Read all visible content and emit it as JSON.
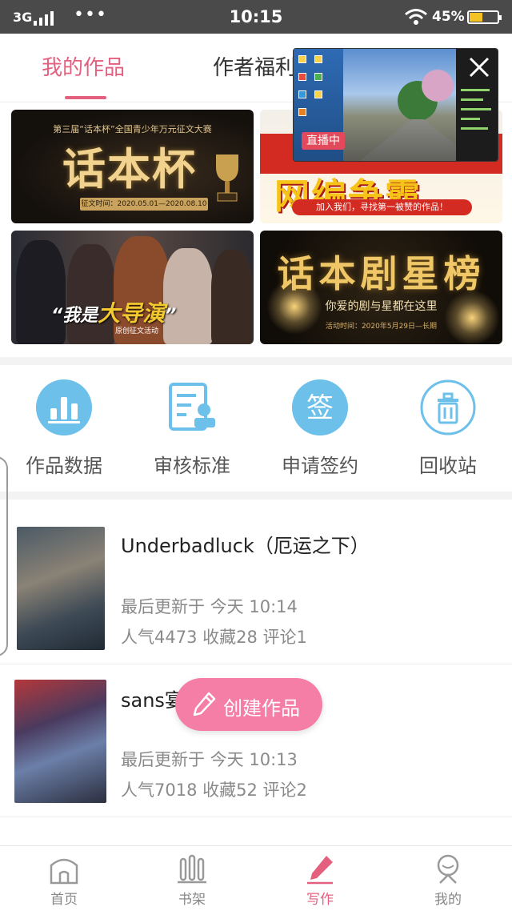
{
  "status_bar": {
    "network": "3G",
    "time": "10:15",
    "battery": "45%",
    "battery_level": 0.45
  },
  "tabs": [
    {
      "label": "我的作品",
      "active": true
    },
    {
      "label": "作者福利",
      "active": false
    }
  ],
  "banners": {
    "b1": {
      "subtitle": "第三届“话本杯”全国青少年万元征文大赛",
      "title": "话本杯",
      "date": "征文时间：2020.05.01—2020.08.10"
    },
    "b2": {
      "title": "网编争霸",
      "strip": "加入我们，寻找第一被赞的作品！"
    },
    "b3": {
      "tagline_pre": "“我是",
      "tagline_em": "大导演",
      "tagline_post": "”",
      "small": "原创征文活动"
    },
    "b4": {
      "title": "话本剧星榜",
      "line1": "你爱的剧与星都在这里",
      "line2": "活动时间：2020年5月29日—长期"
    }
  },
  "live": {
    "badge": "直播中"
  },
  "icons": [
    {
      "label": "作品数据",
      "icon": "bar-chart-icon"
    },
    {
      "label": "审核标准",
      "icon": "document-stamp-icon"
    },
    {
      "label": "申请签约",
      "icon": "sign-icon",
      "glyph": "签"
    },
    {
      "label": "回收站",
      "icon": "trash-icon"
    }
  ],
  "works": [
    {
      "title": "Underbadluck（厄运之下）",
      "updated": "最后更新于 今天 10:14",
      "stats": "人气4473  收藏28  评论1"
    },
    {
      "title": "sans宴",
      "updated": "最后更新于 今天 10:13",
      "stats": "人气7018  收藏52  评论2"
    }
  ],
  "fab": {
    "label": "创建作品"
  },
  "bottom_nav": [
    {
      "label": "首页",
      "icon": "home-icon"
    },
    {
      "label": "书架",
      "icon": "bookshelf-icon"
    },
    {
      "label": "写作",
      "icon": "pen-icon",
      "active": true
    },
    {
      "label": "我的",
      "icon": "profile-icon"
    }
  ],
  "colors": {
    "accent": "#e4607f",
    "fab": "#f57ea6",
    "icon_blue": "#6cc0ea"
  }
}
